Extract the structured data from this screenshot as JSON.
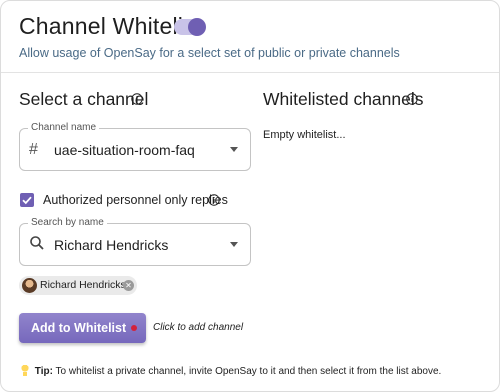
{
  "header": {
    "title": "Channel Whitelist",
    "toggle_on": true,
    "subtitle": "Allow usage of OpenSay for a select set of public or private channels"
  },
  "colors": {
    "accent": "#6f5fb3",
    "button": "#7a6cc0",
    "dot": "#d3213b",
    "subtitle": "#4a6a86"
  },
  "select_channel": {
    "heading": "Select a channel",
    "field_label": "Channel name",
    "prefix": "#",
    "value": "uae-situation-room-faq"
  },
  "authorized": {
    "checked": true,
    "label": "Authorized personnel only replies"
  },
  "search": {
    "field_label": "Search by name",
    "value": "Richard Hendricks"
  },
  "selected_users": [
    {
      "name": "Richard Hendricks"
    }
  ],
  "add_button": {
    "label": "Add to Whitelist",
    "hint": "Click to add channel"
  },
  "whitelisted": {
    "heading": "Whitelisted channels",
    "empty": "Empty whitelist..."
  },
  "tip": {
    "title": "Tip:",
    "text": "To whitelist a private channel, invite OpenSay to it and then select it from the list above."
  },
  "icons": [
    "info-icon",
    "hash-icon",
    "search-icon",
    "chevron-down-icon",
    "check-icon",
    "close-icon",
    "lightbulb-icon"
  ]
}
